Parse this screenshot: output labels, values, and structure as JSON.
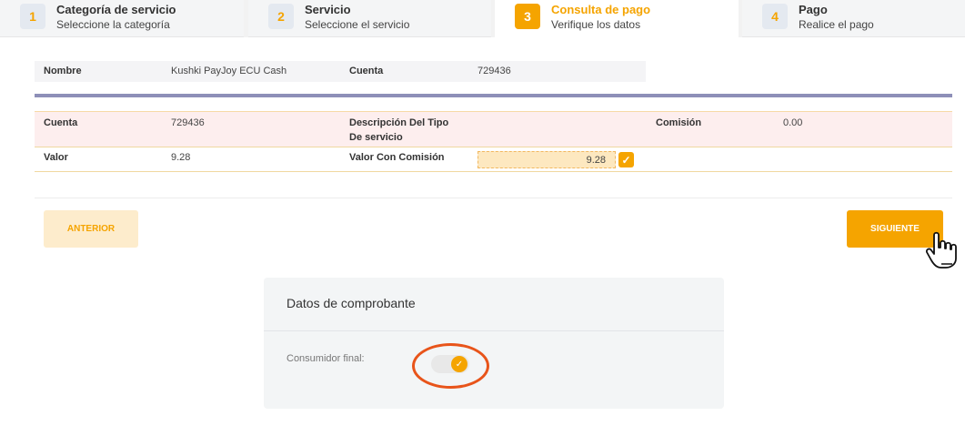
{
  "steps": [
    {
      "num": "1",
      "title": "Categoría de servicio",
      "subtitle": "Seleccione la categoría"
    },
    {
      "num": "2",
      "title": "Servicio",
      "subtitle": "Seleccione el servicio"
    },
    {
      "num": "3",
      "title": "Consulta de pago",
      "subtitle": "Verifique los datos",
      "active": true
    },
    {
      "num": "4",
      "title": "Pago",
      "subtitle": "Realice el pago"
    }
  ],
  "summary": {
    "nombre_label": "Nombre",
    "nombre_value": "Kushki PayJoy ECU Cash",
    "cuenta_label": "Cuenta",
    "cuenta_value": "729436"
  },
  "details": {
    "cuenta_label": "Cuenta",
    "cuenta_value": "729436",
    "descripcion_label_line1": "Descripción Del Tipo",
    "descripcion_label_line2": "De servicio",
    "comision_label": "Comisión",
    "comision_value": "0.00",
    "valor_label": "Valor",
    "valor_value": "9.28",
    "valor_con_comision_label": "Valor Con Comisión",
    "valor_con_comision_value": "9.28",
    "valor_con_comision_checked": true
  },
  "buttons": {
    "prev_label": "ANTERIOR",
    "next_label": "SIGUIENTE"
  },
  "comprobante": {
    "title": "Datos de comprobante",
    "consumidor_label": "Consumidor final:",
    "consumidor_final_on": true
  },
  "colors": {
    "accent": "#f5a400",
    "bar": "#8e8fb8",
    "highlight_circle": "#e8541a"
  },
  "icons": {
    "check": "check-icon",
    "pointer": "hand-pointer-icon"
  }
}
